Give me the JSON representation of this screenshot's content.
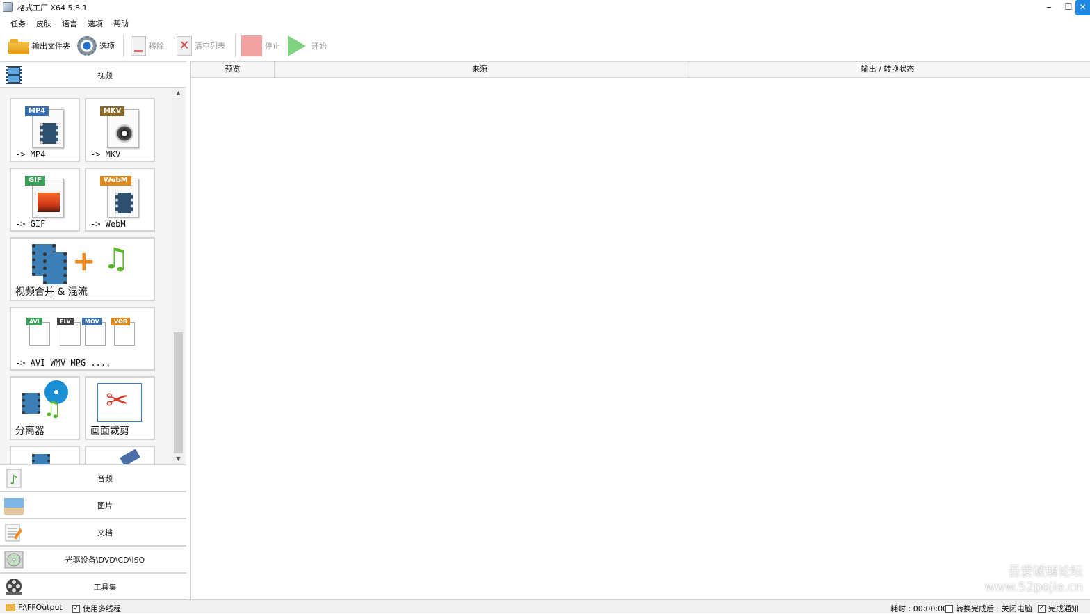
{
  "window": {
    "title": "格式工厂 X64 5.8.1",
    "controls": {
      "minimize": "‒",
      "maximize": "☐",
      "close": "✕"
    }
  },
  "menu": {
    "items": [
      "任务",
      "皮肤",
      "语言",
      "选项",
      "帮助"
    ]
  },
  "toolbar": {
    "output_folder": "输出文件夹",
    "options": "选项",
    "remove": "移除",
    "clear_list": "清空列表",
    "stop": "停止",
    "start": "开始"
  },
  "sidebar": {
    "video_category": "视频",
    "tiles": [
      {
        "tag": "MP4",
        "label": "-> MP4",
        "icon": "mp4-file-icon"
      },
      {
        "tag": "MKV",
        "label": "-> MKV",
        "icon": "mkv-file-icon"
      },
      {
        "tag": "GIF",
        "label": "-> GIF",
        "icon": "gif-file-icon"
      },
      {
        "tag": "WebM",
        "label": "-> WebM",
        "icon": "webm-file-icon"
      },
      {
        "label": "视频合并 & 混流",
        "icon": "video-merge-icon"
      },
      {
        "tags": [
          "AVI",
          "FLV",
          "MOV",
          "VOB"
        ],
        "label": "-> AVI WMV MPG ....",
        "icon": "multi-format-icon"
      },
      {
        "label": "分离器",
        "icon": "splitter-icon"
      },
      {
        "label": "画面裁剪",
        "icon": "crop-icon"
      }
    ],
    "categories": [
      "音频",
      "图片",
      "文档",
      "光驱设备\\DVD\\CD\\ISO",
      "工具集"
    ]
  },
  "task_list": {
    "columns": [
      "预览",
      "来源",
      "输出 / 转换状态"
    ]
  },
  "watermark": {
    "line1": "吾爱破解论坛",
    "line2": "www.52pojie.cn"
  },
  "status": {
    "output_path": "F:\\FFOutput",
    "multithread_label": "使用多线程",
    "multithread_checked": "✓",
    "elapsed": "耗时 : 00:00:00",
    "shutdown_label": "转换完成后 : 关闭电脑",
    "notify_label": "完成通知",
    "notify_checked": "✓"
  },
  "colors": {
    "accent": "#1e88e5",
    "mp4_tag": "#3a6fb0",
    "mkv_tag": "#8a6a2a",
    "gif_tag": "#3aa05a",
    "webm_tag": "#e08a1c"
  }
}
